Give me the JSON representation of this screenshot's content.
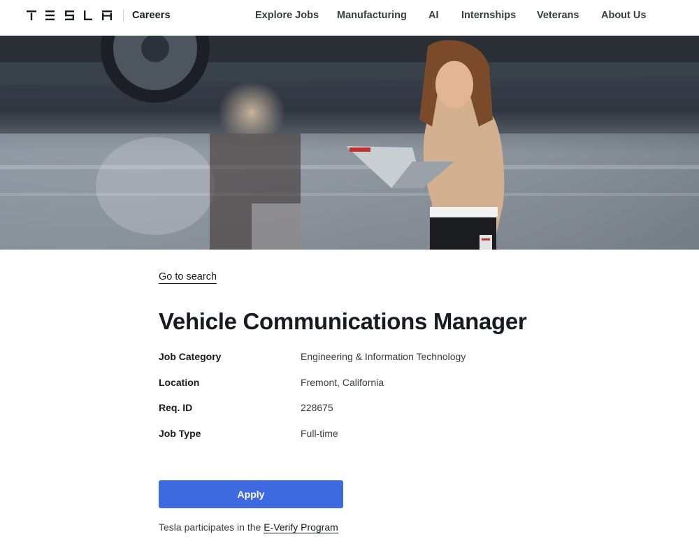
{
  "header": {
    "brand": "TESLA",
    "section": "Careers",
    "nav": [
      {
        "label": "Explore Jobs"
      },
      {
        "label": "Manufacturing"
      },
      {
        "label": "AI"
      },
      {
        "label": "Internships"
      },
      {
        "label": "Veterans"
      },
      {
        "label": "About Us"
      }
    ]
  },
  "hero": {
    "image": "photo of people walking past a car with a laptop",
    "icon": "hero-photo"
  },
  "main": {
    "back_link": "Go to search",
    "title": "Vehicle Communications Manager",
    "details": [
      {
        "label": "Job Category",
        "value": "Engineering & Information Technology"
      },
      {
        "label": "Location",
        "value": "Fremont, California"
      },
      {
        "label": "Req. ID",
        "value": "228675"
      },
      {
        "label": "Job Type",
        "value": "Full-time"
      }
    ],
    "apply_label": "Apply",
    "everify_prefix": "Tesla participates in the ",
    "everify_link": "E-Verify Program"
  },
  "colors": {
    "accent": "#3e6ae1",
    "text": "#171a20",
    "muted": "#393c41"
  }
}
